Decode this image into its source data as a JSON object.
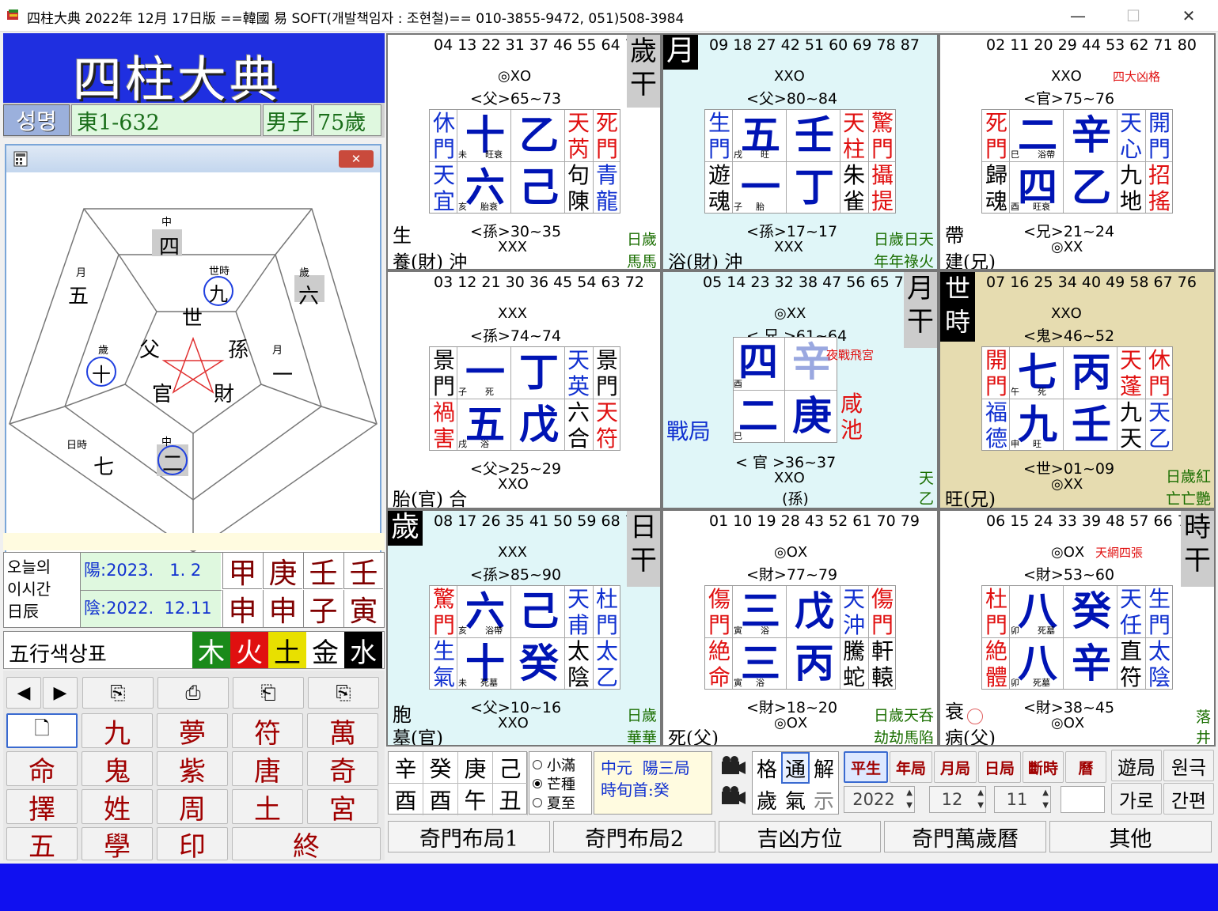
{
  "window": {
    "title": "四柱大典 2022年 12月 17日版 ==韓國 易 SOFT(개발책임자 : 조현철)== 010-3855-9472, 051)508-3984",
    "minimize": "—",
    "maximize": "☐",
    "close": "✕"
  },
  "left": {
    "logo": "四柱大典",
    "name_label": "성명",
    "name_value": "東1-632",
    "gender": "男子",
    "age": "75歲",
    "popup": {
      "close": "✕",
      "pentagon": {
        "top_label": "中",
        "top_num": "四",
        "ul_label": "月",
        "ul_num": "五",
        "ur_label": "歲",
        "ur_num": "六",
        "inner_top_label": "世時",
        "inner_top_num": "九",
        "inner_left_label": "歲",
        "inner_left_num": "十",
        "inner_right_label": "月",
        "inner_right_num": "一",
        "bl_label": "日時",
        "bl_num": "七",
        "bottom_label": "中",
        "bottom_num": "二",
        "center_top": "世",
        "center_left": "父",
        "center_right": "孫",
        "center_bl": "官",
        "center_br": "財"
      }
    },
    "today": {
      "label": "오늘의 이시간 日辰",
      "label_lines": [
        "오늘의",
        "이시간",
        "日辰"
      ],
      "yang": "陽:2023.   1. 2",
      "eum": "陰:2022.  12.11",
      "stems": [
        "甲",
        "庚",
        "壬",
        "壬"
      ],
      "branches": [
        "申",
        "申",
        "子",
        "寅"
      ]
    },
    "five_elements": {
      "label": "五行색상표",
      "items": [
        "木",
        "火",
        "土",
        "金",
        "水"
      ],
      "colors": [
        "#1a8a1a",
        "#e01010",
        "#e8e000",
        "#ffffff",
        "#000000"
      ]
    },
    "buttons": [
      [
        "◀",
        "▶",
        "⎘",
        "⎙",
        "⎗",
        "⎘"
      ],
      [
        "🗋",
        "九",
        "夢",
        "符",
        "萬"
      ],
      [
        "命",
        "鬼",
        "紫",
        "唐",
        "奇"
      ],
      [
        "擇",
        "姓",
        "周",
        "土",
        "宮"
      ],
      [
        "五",
        "學",
        "印",
        "終"
      ]
    ]
  },
  "palaces": [
    {
      "nums": "04 13 22 31 37 46 55 64 73",
      "symbols": "◎ⅩO",
      "rel_top": "<父>65~73",
      "rel_bottom": "<孫>30~35",
      "sym_bottom": "ⅩⅩⅩ",
      "left_top": [
        "休",
        "門"
      ],
      "left_bottom": [
        "天",
        "宜"
      ],
      "big_tl": "十",
      "big_tr": "乙",
      "big_bl": "六",
      "big_br": "己",
      "sm_tl": "未",
      "sm_tr": "旺衰",
      "sm_bl": "亥",
      "sm_br": "胎衰",
      "right_top_a": [
        "天",
        "芮"
      ],
      "right_top_b": [
        "死",
        "門"
      ],
      "right_bottom_a": [
        "句",
        "陳"
      ],
      "right_bottom_b": [
        "青",
        "龍"
      ],
      "corner_label": "歲干",
      "bl_line1": "生",
      "bl_line2": "養(財) 沖",
      "br_line1": "日歲",
      "br_line2": "馬馬"
    },
    {
      "nums": "09 18 27 42 51 60 69 78 87",
      "symbols": "ⅩⅩO",
      "rel_top": "<父>80~84",
      "rel_bottom": "<孫>17~17",
      "sym_bottom": "ⅩⅩⅩ",
      "left_top": [
        "生",
        "門"
      ],
      "left_bottom": [
        "遊",
        "魂"
      ],
      "big_tl": "五",
      "big_tr": "壬",
      "big_bl": "一",
      "big_br": "丁",
      "sm_tl": "戌",
      "sm_tr": "旺",
      "sm_bl": "子",
      "sm_br": "胎",
      "right_top_a": [
        "天",
        "柱"
      ],
      "right_top_b": [
        "驚",
        "門"
      ],
      "right_bottom_a": [
        "朱",
        "雀"
      ],
      "right_bottom_b": [
        "攝",
        "提"
      ],
      "corner_label": "月",
      "bl_line2": "浴(財) 沖",
      "br_line1": "日歲日天",
      "br_line2": "年年祿火"
    },
    {
      "nums": "02 11 20 29 44 53 62 71 80",
      "symbols": "ⅩⅩO",
      "rel_top": "<官>75~76",
      "rel_bottom": "<兄>21~24",
      "sym_bottom": "◎ⅩⅩ",
      "tag": "四大凶格",
      "left_top": [
        "死",
        "門"
      ],
      "left_bottom": [
        "歸",
        "魂"
      ],
      "big_tl": "二",
      "big_tr": "辛",
      "big_bl": "四",
      "big_br": "乙",
      "sm_tl": "巳",
      "sm_tr": "浴帶",
      "sm_bl": "酉",
      "sm_br": "旺衰",
      "right_top_a": [
        "天",
        "心"
      ],
      "right_top_b": [
        "開",
        "門"
      ],
      "right_bottom_a": [
        "九",
        "地"
      ],
      "right_bottom_b": [
        "招",
        "搖"
      ],
      "bl_line1": "帶",
      "bl_line2": "建(兄)"
    },
    {
      "nums": "03 12 21 30 36 45 54 63 72",
      "symbols": "ⅩⅩⅩ",
      "rel_top": "<孫>74~74",
      "rel_bottom": "<父>25~29",
      "sym_bottom": "ⅩⅩO",
      "left_top": [
        "景",
        "門"
      ],
      "left_bottom": [
        "禍",
        "害"
      ],
      "big_tl": "一",
      "big_tr": "丁",
      "big_bl": "五",
      "big_br": "戊",
      "sm_tl": "子",
      "sm_tr": "死",
      "sm_bl": "戌",
      "sm_br": "浴",
      "right_top_a": [
        "天",
        "英"
      ],
      "right_top_b": [
        "景",
        "門"
      ],
      "right_bottom_a": [
        "六",
        "合"
      ],
      "right_bottom_b": [
        "天",
        "符"
      ],
      "bl_line2": "胎(官) 合"
    },
    {
      "nums": "05 14 23 32 38 47 56 65 74",
      "symbols": "◎ⅩⅩ",
      "rel_top": "< 兄 >61~64",
      "rel_bottom": "< 官 >36~37",
      "sym_bottom": "ⅩⅩO",
      "tag": "夜戰飛宮",
      "center_side": "戰局",
      "big_tl": "四",
      "big_tr": "辛",
      "big_bl": "二",
      "big_br": "庚",
      "sm_tl": "酉",
      "sm_bl": "巳",
      "right_b": [
        "咸",
        "池"
      ],
      "corner_label": "月干",
      "sub": "(孫)",
      "br_line1": "天",
      "br_line2": "乙"
    },
    {
      "nums": "07 16 25 34 40 49 58 67 76",
      "symbols": "ⅩⅩO",
      "rel_top": "<鬼>46~52",
      "rel_bottom": "<世>01~09",
      "sym_bottom": "◎ⅩⅩ",
      "corner_label": "世時",
      "left_top": [
        "開",
        "門"
      ],
      "left_bottom": [
        "福",
        "德"
      ],
      "big_tl": "七",
      "big_tr": "丙",
      "big_bl": "九",
      "big_br": "壬",
      "sm_tl": "午",
      "sm_tr": "死",
      "sm_bl": "申",
      "sm_br": "旺",
      "right_top_a": [
        "天",
        "蓬"
      ],
      "right_top_b": [
        "休",
        "門"
      ],
      "right_bottom_a": [
        "九",
        "天"
      ],
      "right_bottom_b": [
        "天",
        "乙"
      ],
      "bl_line2": "旺(兄)",
      "br_line1": "日歲紅",
      "br_line2": "亡亡艷"
    },
    {
      "nums": "08 17 26 35 41 50 59 68 77",
      "symbols": "ⅩⅩⅩ",
      "rel_top": "<孫>85~90",
      "rel_bottom": "<父>10~16",
      "sym_bottom": "ⅩⅩO",
      "corner_tl": "歲",
      "corner_label": "日干",
      "left_top": [
        "驚",
        "門"
      ],
      "left_bottom": [
        "生",
        "氣"
      ],
      "big_tl": "六",
      "big_tr": "己",
      "big_bl": "十",
      "big_br": "癸",
      "sm_tl": "亥",
      "sm_tr": "浴帶",
      "sm_bl": "未",
      "sm_br": "死墓",
      "right_top_a": [
        "天",
        "甫"
      ],
      "right_top_b": [
        "杜",
        "門"
      ],
      "right_bottom_a": [
        "太",
        "陰"
      ],
      "right_bottom_b": [
        "太",
        "乙"
      ],
      "bl_line1": "胞",
      "bl_line2": "墓(官)",
      "br_line1": "日歲",
      "br_line2": "華華"
    },
    {
      "nums": "01 10 19 28 43 52 61 70 79",
      "symbols": "◎OⅩ",
      "rel_top": "<財>77~79",
      "rel_bottom": "<財>18~20",
      "sym_bottom": "◎OⅩ",
      "left_top": [
        "傷",
        "門"
      ],
      "left_bottom": [
        "絶",
        "命"
      ],
      "big_tl": "三",
      "big_tr": "戊",
      "big_bl": "三",
      "big_br": "丙",
      "sm_tl": "寅",
      "sm_tr": "浴",
      "sm_bl": "寅",
      "sm_br": "浴",
      "right_top_a": [
        "天",
        "沖"
      ],
      "right_top_b": [
        "傷",
        "門"
      ],
      "right_bottom_a": [
        "騰",
        "蛇"
      ],
      "right_bottom_b": [
        "軒",
        "轅"
      ],
      "bl_line2": "死(父)",
      "br_line1": "日歲天呑",
      "br_line2": "劫劫馬陷"
    },
    {
      "nums": "06 15 24 33 39 48 57 66 75",
      "symbols": "◎OⅩ",
      "rel_top": "<財>53~60",
      "rel_bottom": "<財>38~45",
      "sym_bottom": "◎OⅩ",
      "tag": "天網四張",
      "corner_label": "時干",
      "left_top": [
        "杜",
        "門"
      ],
      "left_bottom": [
        "絶",
        "體"
      ],
      "big_tl": "八",
      "big_tr": "癸",
      "big_bl": "八",
      "big_br": "辛",
      "sm_tl": "卯",
      "sm_tr": "死墓",
      "sm_bl": "卯",
      "sm_br": "死墓",
      "right_top_a": [
        "天",
        "任"
      ],
      "right_top_b": [
        "生",
        "門"
      ],
      "right_bottom_a": [
        "直",
        "符"
      ],
      "right_bottom_b": [
        "太",
        "陰"
      ],
      "bl_line1": "衰",
      "bl_line2": "病(父)",
      "br_line1": "落",
      "br_line2": "井"
    }
  ],
  "bottom": {
    "pillars_top": [
      "辛",
      "癸",
      "庚",
      "己"
    ],
    "pillars_bottom": [
      "酉",
      "酉",
      "午",
      "丑"
    ],
    "terms": [
      "小滿",
      "芒種",
      "夏至"
    ],
    "term_selected": 1,
    "ju_line1": "中元  陽三局",
    "ju_line2": "時旬首:癸",
    "opt_top": [
      "格",
      "通",
      "解"
    ],
    "opt_bottom": [
      "歲",
      "氣",
      "示"
    ],
    "modes": [
      "平生",
      "年局",
      "月局",
      "日局",
      "斷時",
      "曆"
    ],
    "year": "2022",
    "month": "12",
    "day": "11",
    "right_top": [
      "遊局",
      "원극"
    ],
    "right_bottom": [
      "가로",
      "간편"
    ],
    "tabs": [
      "奇門布局1",
      "奇門布局2",
      "吉凶方位",
      "奇門萬歲曆",
      "其他"
    ]
  }
}
